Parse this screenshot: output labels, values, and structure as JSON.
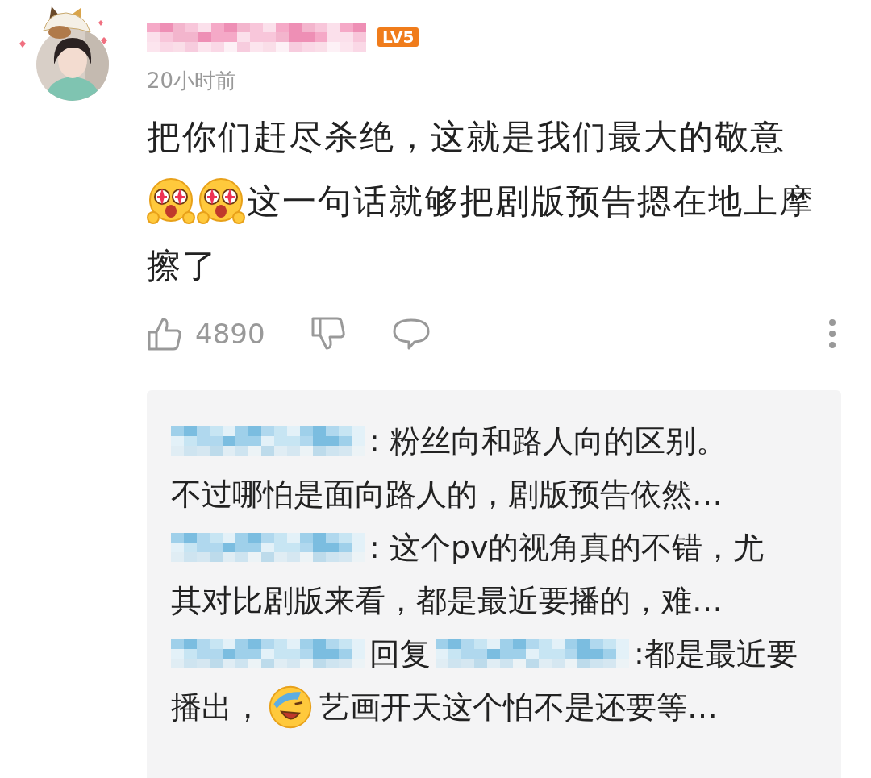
{
  "comment": {
    "level_badge": "LV5",
    "time": "20小时前",
    "paragraphs": [
      [
        [
          {
            "kind": "text",
            "text": "把你们赶尽杀绝，这就是我们最大的敬意"
          }
        ]
      ],
      [
        [
          {
            "kind": "amazed"
          },
          {
            "kind": "amazed"
          },
          {
            "kind": "text",
            "text": "这一句话就够把剧版预告摁在地上摩"
          }
        ],
        [
          {
            "kind": "text",
            "text": "擦了"
          }
        ]
      ]
    ],
    "like_count": "4890",
    "replies": [
      {
        "lines": [
          [
            {
              "kind": "name"
            },
            {
              "kind": "text",
              "text": ": 粉丝向和路人向的区别。"
            }
          ],
          [
            {
              "kind": "text",
              "text": "不过哪怕是面向路人的，剧版预告依然…"
            }
          ]
        ]
      },
      {
        "lines": [
          [
            {
              "kind": "name"
            },
            {
              "kind": "text",
              "text": ": 这个pv的视角真的不错，尤"
            }
          ],
          [
            {
              "kind": "text",
              "text": "其对比剧版来看，都是最近要播的，难…"
            }
          ]
        ]
      },
      {
        "lines": [
          [
            {
              "kind": "name"
            },
            {
              "kind": "text",
              "text": "回复"
            },
            {
              "kind": "name"
            },
            {
              "kind": "text",
              "text": ":都是最近要"
            }
          ],
          [
            {
              "kind": "text",
              "text": "播出，"
            },
            {
              "kind": "laughing"
            },
            {
              "kind": "text",
              "text": "艺画开天这个怕不是还要等…"
            }
          ]
        ]
      }
    ]
  }
}
